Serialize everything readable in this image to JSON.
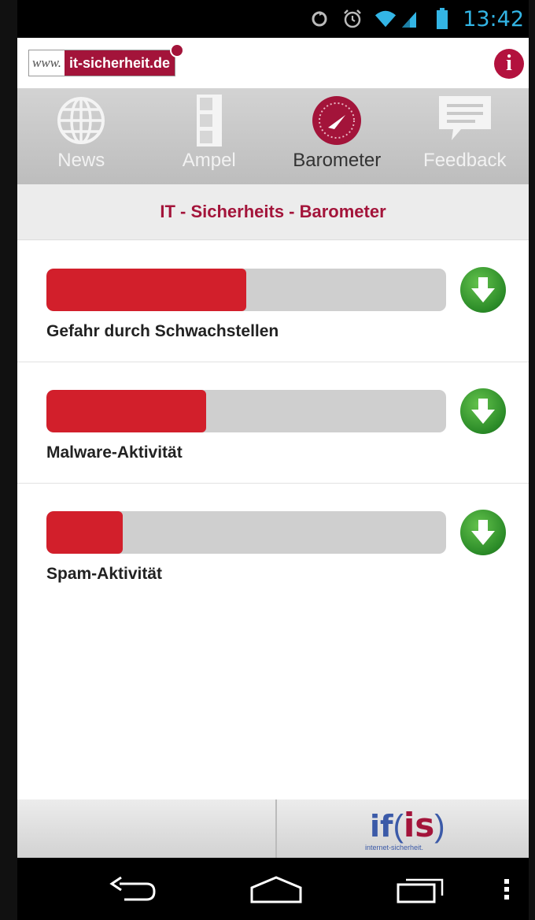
{
  "status_bar": {
    "time": "13:42",
    "icons": [
      "sync-icon",
      "alarm-icon",
      "wifi-icon",
      "signal-icon",
      "battery-icon"
    ]
  },
  "header": {
    "logo_prefix": "www.",
    "logo_domain": "it-sicherheit.de",
    "info_icon": "info-icon"
  },
  "tabs": [
    {
      "label": "News",
      "icon": "globe-icon",
      "active": false
    },
    {
      "label": "Ampel",
      "icon": "traffic-light-icon",
      "active": false
    },
    {
      "label": "Barometer",
      "icon": "gauge-icon",
      "active": true
    },
    {
      "label": "Feedback",
      "icon": "speech-bubble-icon",
      "active": false
    }
  ],
  "section_title": "IT - Sicherheits - Barometer",
  "metrics": [
    {
      "label": "Gefahr durch Schwachstellen",
      "level_fraction": 0.5,
      "trend": "down",
      "trend_icon": "arrow-down-icon"
    },
    {
      "label": "Malware-Aktivität",
      "level_fraction": 0.4,
      "trend": "down",
      "trend_icon": "arrow-down-icon"
    },
    {
      "label": "Spam-Aktivität",
      "level_fraction": 0.19,
      "trend": "down",
      "trend_icon": "arrow-down-icon"
    }
  ],
  "footer": {
    "logo_text_if": "if",
    "logo_text_is": "is",
    "logo_subtitle": "internet-sicherheit."
  },
  "colors": {
    "brand": "#a3143a",
    "bar_fill": "#d21f2b",
    "bar_track": "#cfcfcf",
    "trend_down": "#2a8a27",
    "status_text": "#33b5e5"
  }
}
